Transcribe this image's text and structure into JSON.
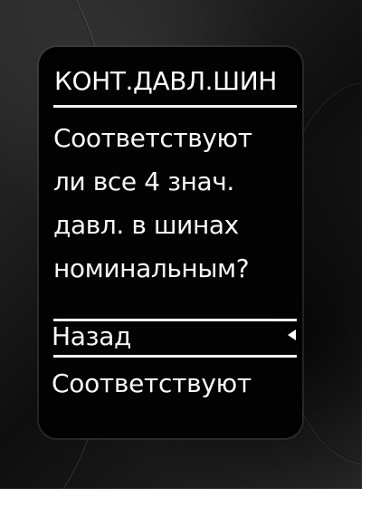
{
  "screen": {
    "title": "КОНТ.ДАВЛ.ШИН",
    "question_lines": [
      "Соответствуют",
      "ли все 4 знач.",
      "давл. в шинах",
      "номинальным?"
    ],
    "menu": {
      "back": "Назад",
      "confirm": "Соответствуют",
      "selected_item": "Назад"
    }
  },
  "colors": {
    "display_background": "#030303",
    "text": "#f7f7f7",
    "separator": "#f3f3f3"
  },
  "icons": {
    "selection_marker": "left-pointing-triangle"
  }
}
